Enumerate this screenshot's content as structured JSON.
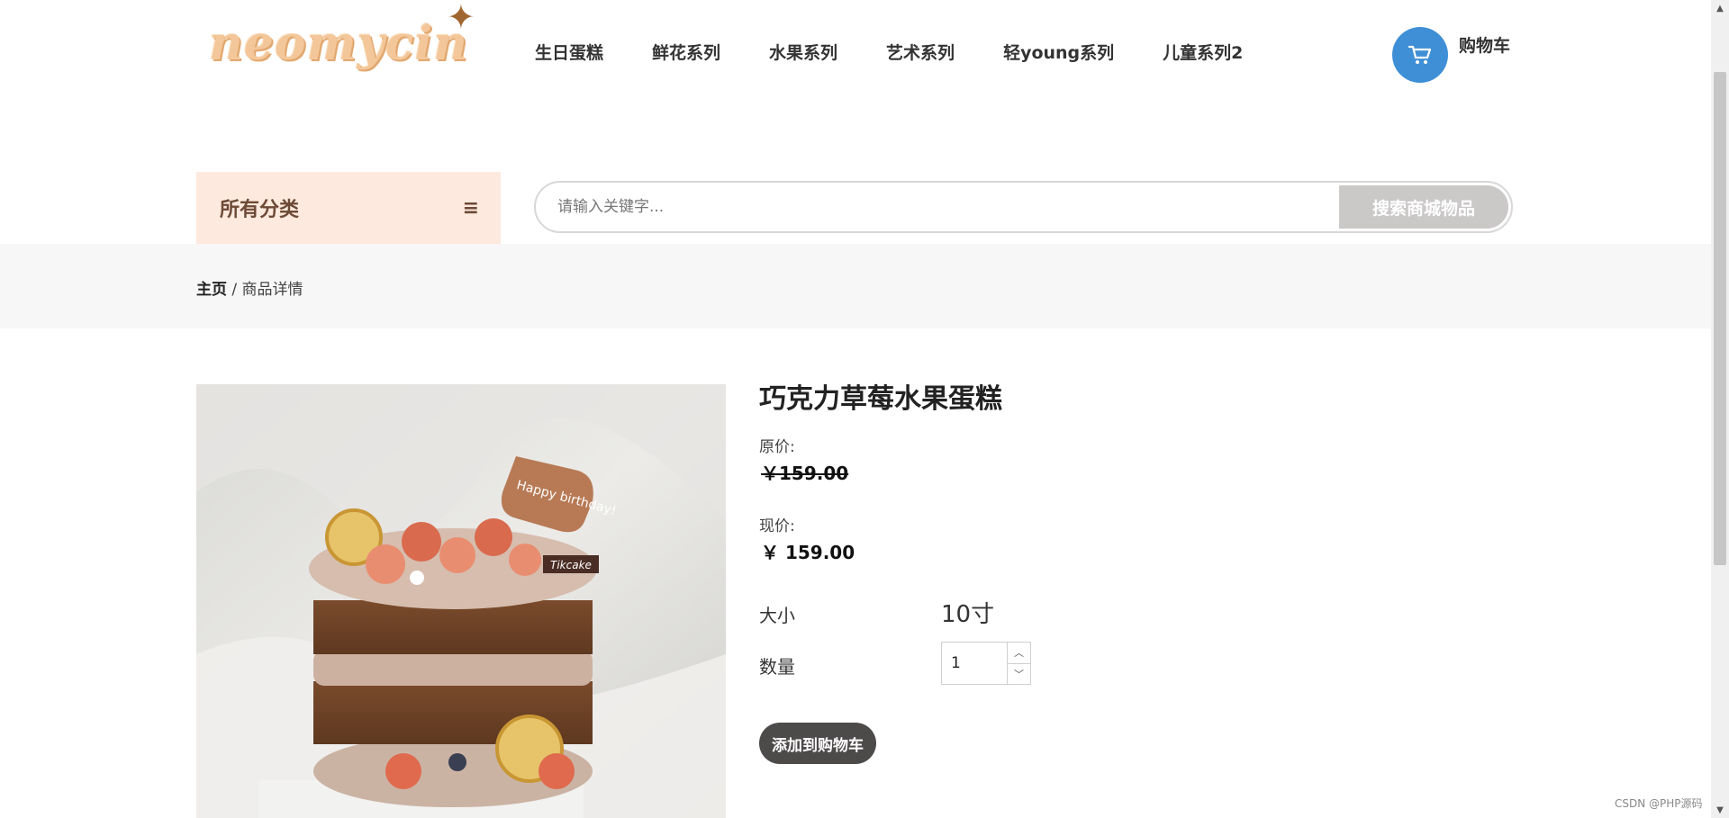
{
  "header": {
    "logo_text": "neomycin",
    "nav": [
      {
        "label": "生日蛋糕"
      },
      {
        "label": "鲜花系列"
      },
      {
        "label": "水果系列"
      },
      {
        "label": "艺术系列"
      },
      {
        "label": "轻young系列"
      },
      {
        "label": "儿童系列2"
      }
    ],
    "cart_label": "购物车",
    "cart_icon": "cart-icon"
  },
  "search": {
    "category_label": "所有分类",
    "menu_icon": "menu-icon",
    "placeholder": "请输入关键字...",
    "button_label": "搜索商城物品"
  },
  "breadcrumb": {
    "home": "主页",
    "separator": " / ",
    "current": "商品详情"
  },
  "product": {
    "title": "巧克力草莓水果蛋糕",
    "original_price_label": "原价:",
    "original_price": "￥159.00",
    "current_price_label": "现价:",
    "current_price": "￥ 159.00",
    "size_label": "大小",
    "size_value": "10寸",
    "quantity_label": "数量",
    "quantity_value": "1",
    "add_to_cart_label": "添加到购物车",
    "image_topper_text": "Happy birthday!",
    "image_tag_text": "Tikcake"
  },
  "watermark": "CSDN @PHP源码",
  "colors": {
    "accent_blue": "#3f8fd6",
    "category_bg": "#fde9dd",
    "search_button_bg": "#cbc8c8",
    "add_cart_bg": "#4d4a4a"
  }
}
